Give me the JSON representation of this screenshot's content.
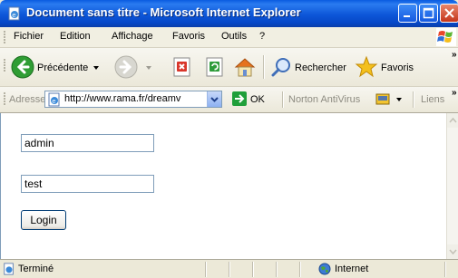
{
  "window": {
    "title": "Document sans titre - Microsoft Internet Explorer"
  },
  "menu": {
    "items": [
      "Fichier",
      "Edition",
      "Affichage",
      "Favoris",
      "Outils",
      "?"
    ]
  },
  "toolbar": {
    "back_label": "Précédente",
    "search_label": "Rechercher",
    "favorites_label": "Favoris"
  },
  "address": {
    "label": "Adresse",
    "url": "http://www.rama.fr/dreamv",
    "go_label": "OK",
    "norton_label": "Norton AntiVirus",
    "links_label": "Liens"
  },
  "form": {
    "username_value": "admin",
    "password_value": "test",
    "login_label": "Login"
  },
  "status": {
    "text": "Terminé",
    "zone": "Internet"
  },
  "colors": {
    "titlebar": "#0a5ce0",
    "chrome": "#ece9d8",
    "close": "#c5361b"
  }
}
